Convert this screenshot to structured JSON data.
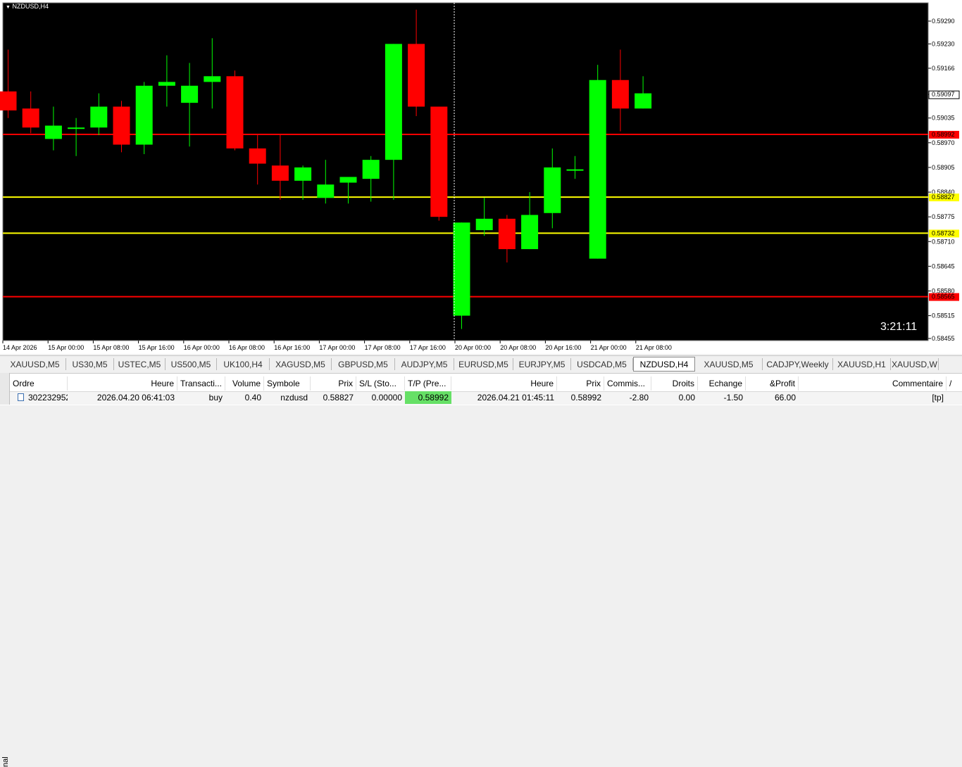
{
  "chart": {
    "symbol_label": "NZDUSD,H4",
    "timer": "3:21:11",
    "colors": {
      "bull": "#00ff00",
      "bear": "#ff0000",
      "background": "#000000",
      "axis_text": "#000000",
      "tp_line": "#ff0000",
      "entry_line": "#ffff00"
    }
  },
  "chart_data": {
    "type": "candlestick",
    "symbol": "NZDUSD",
    "timeframe": "H4",
    "y_ticks": [
      "0.59290",
      "0.59230",
      "0.59166",
      "0.59097",
      "0.59035",
      "0.58970",
      "0.58905",
      "0.58840",
      "0.58775",
      "0.58710",
      "0.58645",
      "0.58580",
      "0.58515",
      "0.58455"
    ],
    "ylim": [
      0.58455,
      0.5932
    ],
    "x_ticks": [
      "14 Apr 2026",
      "15 Apr 00:00",
      "15 Apr 08:00",
      "15 Apr 16:00",
      "16 Apr 00:00",
      "16 Apr 08:00",
      "16 Apr 16:00",
      "17 Apr 00:00",
      "17 Apr 08:00",
      "17 Apr 16:00",
      "20 Apr 00:00",
      "20 Apr 08:00",
      "20 Apr 16:00",
      "21 Apr 00:00",
      "21 Apr 08:00"
    ],
    "current_price": "0.59097",
    "hlines": [
      {
        "price": 0.58992,
        "label": "0.58992",
        "color": "#ff0000"
      },
      {
        "price": 0.58827,
        "label": "0.58827",
        "color": "#ffff00"
      },
      {
        "price": 0.58732,
        "label": "0.58732",
        "color": "#ffff00"
      },
      {
        "price": 0.58565,
        "label": "0.58565",
        "color": "#ff0000"
      }
    ],
    "candles": [
      {
        "o": 0.59105,
        "h": 0.59215,
        "l": 0.59035,
        "c": 0.59055
      },
      {
        "o": 0.5906,
        "h": 0.59105,
        "l": 0.58995,
        "c": 0.5901
      },
      {
        "o": 0.5898,
        "h": 0.59065,
        "l": 0.5895,
        "c": 0.59015
      },
      {
        "o": 0.5901,
        "h": 0.59035,
        "l": 0.58935,
        "c": 0.5901
      },
      {
        "o": 0.5901,
        "h": 0.591,
        "l": 0.5899,
        "c": 0.59065
      },
      {
        "o": 0.59065,
        "h": 0.5908,
        "l": 0.58945,
        "c": 0.58965
      },
      {
        "o": 0.58965,
        "h": 0.5913,
        "l": 0.5894,
        "c": 0.5912
      },
      {
        "o": 0.5912,
        "h": 0.592,
        "l": 0.59065,
        "c": 0.5913
      },
      {
        "o": 0.59075,
        "h": 0.5918,
        "l": 0.5896,
        "c": 0.5912
      },
      {
        "o": 0.5913,
        "h": 0.59245,
        "l": 0.5906,
        "c": 0.59145
      },
      {
        "o": 0.59145,
        "h": 0.5916,
        "l": 0.5895,
        "c": 0.58955
      },
      {
        "o": 0.58955,
        "h": 0.5899,
        "l": 0.5886,
        "c": 0.58915
      },
      {
        "o": 0.5891,
        "h": 0.5899,
        "l": 0.5882,
        "c": 0.5887
      },
      {
        "o": 0.5887,
        "h": 0.5891,
        "l": 0.5882,
        "c": 0.58905
      },
      {
        "o": 0.58825,
        "h": 0.58925,
        "l": 0.5881,
        "c": 0.5886
      },
      {
        "o": 0.58865,
        "h": 0.5888,
        "l": 0.5881,
        "c": 0.5888
      },
      {
        "o": 0.58875,
        "h": 0.58935,
        "l": 0.58815,
        "c": 0.58925
      },
      {
        "o": 0.58925,
        "h": 0.5923,
        "l": 0.5882,
        "c": 0.5923
      },
      {
        "o": 0.5923,
        "h": 0.5932,
        "l": 0.5904,
        "c": 0.59065
      },
      {
        "o": 0.59065,
        "h": 0.59065,
        "l": 0.58765,
        "c": 0.58775
      },
      {
        "o": 0.58515,
        "h": 0.5876,
        "l": 0.5848,
        "c": 0.5876
      },
      {
        "o": 0.5874,
        "h": 0.58825,
        "l": 0.58725,
        "c": 0.5877
      },
      {
        "o": 0.5877,
        "h": 0.5878,
        "l": 0.58655,
        "c": 0.5869
      },
      {
        "o": 0.5869,
        "h": 0.5884,
        "l": 0.5869,
        "c": 0.5878
      },
      {
        "o": 0.58785,
        "h": 0.58955,
        "l": 0.58745,
        "c": 0.58905
      },
      {
        "o": 0.589,
        "h": 0.58935,
        "l": 0.58875,
        "c": 0.589
      },
      {
        "o": 0.58665,
        "h": 0.59175,
        "l": 0.58665,
        "c": 0.59135
      },
      {
        "o": 0.59135,
        "h": 0.59215,
        "l": 0.59,
        "c": 0.5906
      },
      {
        "o": 0.5906,
        "h": 0.59145,
        "l": 0.5906,
        "c": 0.591
      }
    ]
  },
  "tabs": [
    {
      "label": "XAUUSD,M5",
      "active": false
    },
    {
      "label": "US30,M5",
      "active": false
    },
    {
      "label": "USTEC,M5",
      "active": false
    },
    {
      "label": "US500,M5",
      "active": false
    },
    {
      "label": "UK100,H4",
      "active": false
    },
    {
      "label": "XAGUSD,M5",
      "active": false
    },
    {
      "label": "GBPUSD,M5",
      "active": false
    },
    {
      "label": "AUDJPY,M5",
      "active": false
    },
    {
      "label": "EURUSD,M5",
      "active": false
    },
    {
      "label": "EURJPY,M5",
      "active": false
    },
    {
      "label": "USDCAD,M5",
      "active": false
    },
    {
      "label": "NZDUSD,H4",
      "active": true
    },
    {
      "label": "XAUUSD,M5",
      "active": false
    },
    {
      "label": "CADJPY,Weekly",
      "active": false
    },
    {
      "label": "XAUUSD,H1",
      "active": false
    },
    {
      "label": "XAUUSD,W",
      "active": false
    }
  ],
  "orders": {
    "side_label": "nal",
    "headers": [
      "Ordre",
      "Heure",
      "Transacti...",
      "Volume",
      "Symbole",
      "Prix",
      "S/L (Sto...",
      "T/P (Pre...",
      "Heure",
      "Prix",
      "Commis...",
      "Droits",
      "Echange",
      "&Profit",
      "Commentaire"
    ],
    "sort_arrow": "/",
    "row": [
      "302232952",
      "2026.04.20 06:41:03",
      "buy",
      "0.40",
      "nzdusd",
      "0.58827",
      "0.00000",
      "0.58992",
      "2026.04.21 01:45:11",
      "0.58992",
      "-2.80",
      "0.00",
      "-1.50",
      "66.00",
      "[tp]"
    ],
    "tp_highlight": "#66e066"
  }
}
